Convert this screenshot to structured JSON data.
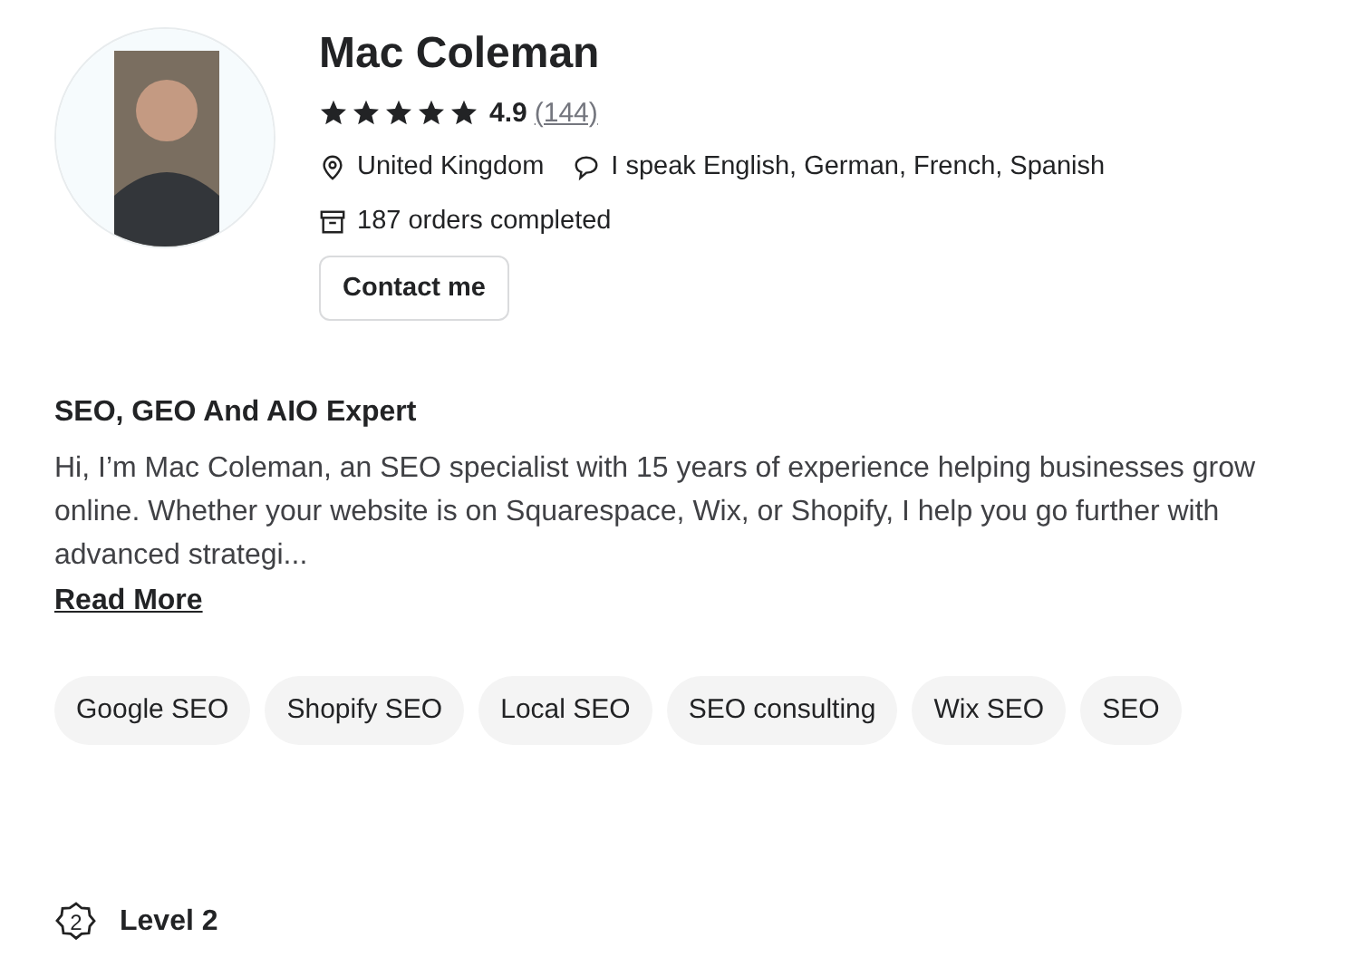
{
  "profile": {
    "name": "Mac Coleman",
    "stars": 5,
    "rating": "4.9",
    "reviews": "(144)",
    "location": "United Kingdom",
    "languages": "I speak English, German, French, Spanish",
    "orders": "187 orders completed",
    "contact_button": "Contact me"
  },
  "about": {
    "title": "SEO, GEO And AIO Expert",
    "text": "Hi, I’m Mac Coleman, an SEO specialist with 15 years of experience helping businesses grow online. Whether your website is on Squarespace, Wix, or Shopify, I help you go further with advanced strategi...",
    "read_more": "Read More"
  },
  "tags": [
    "Google SEO",
    "Shopify SEO",
    "Local SEO",
    "SEO consulting",
    "Wix SEO",
    "SEO"
  ],
  "level": {
    "badge": "2",
    "label": "Level 2"
  }
}
